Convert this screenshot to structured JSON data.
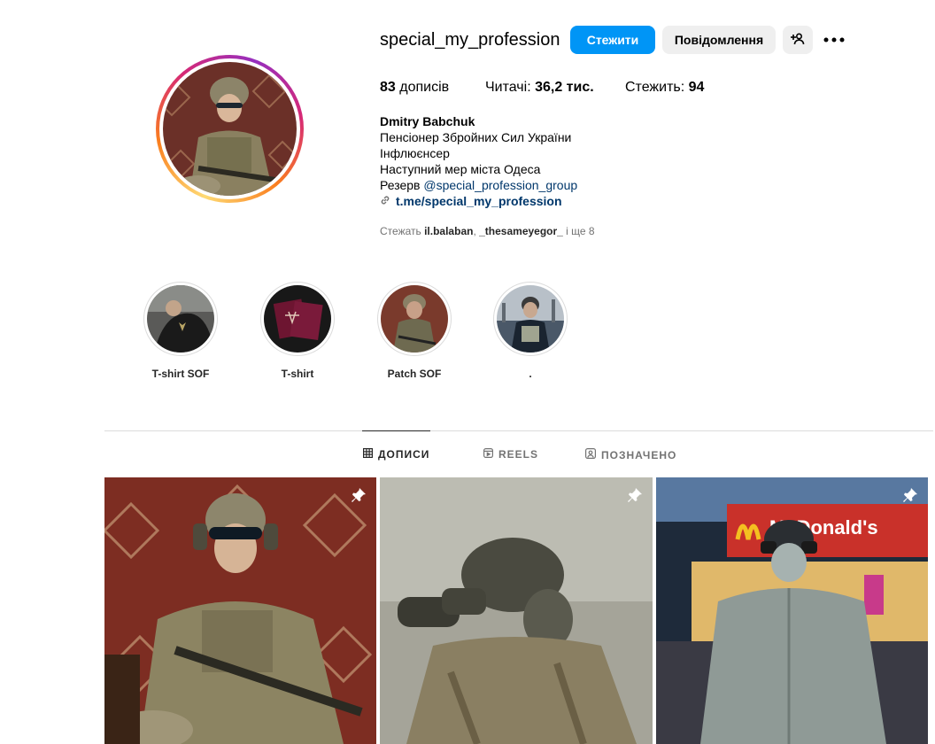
{
  "profile": {
    "username": "special_my_profession",
    "follow_label": "Стежити",
    "message_label": "Повідомлення",
    "stats": {
      "posts_value": "83",
      "posts_label": "дописів",
      "followers_label": "Читачі:",
      "followers_value": "36,2 тис.",
      "following_label": "Стежить:",
      "following_value": "94"
    },
    "bio": {
      "name": "Dmitry Babchuk",
      "line1": "Пенсіонер Збройних Сил України",
      "line2": "Інфлюєнсер",
      "line3": "Наступний мер міста Одеса",
      "line4_prefix": "Резерв ",
      "line4_mention": "@special_profession_group",
      "link": "t.me/special_my_profession"
    },
    "followed_by": {
      "prefix": "Стежать ",
      "user1": "il.balaban",
      "sep": ", ",
      "user2": "_thesameyegor_",
      "suffix": " і ще 8"
    }
  },
  "highlights": [
    {
      "label": "T-shirt SOF"
    },
    {
      "label": "T-shirt"
    },
    {
      "label": "Patch SOF"
    },
    {
      "label": "."
    }
  ],
  "tabs": [
    {
      "label": "ДОПИСИ",
      "icon": "grid-icon",
      "active": true
    },
    {
      "label": "REELS",
      "icon": "reels-icon",
      "active": false
    },
    {
      "label": "ПОЗНАЧЕНО",
      "icon": "tagged-icon",
      "active": false
    }
  ],
  "posts": [
    {
      "pinned": true
    },
    {
      "pinned": true
    },
    {
      "pinned": true,
      "sign_text": "McDonald's"
    }
  ],
  "colors": {
    "accent": "#0095f6",
    "secondary_button": "#efefef",
    "link": "#00376b"
  }
}
